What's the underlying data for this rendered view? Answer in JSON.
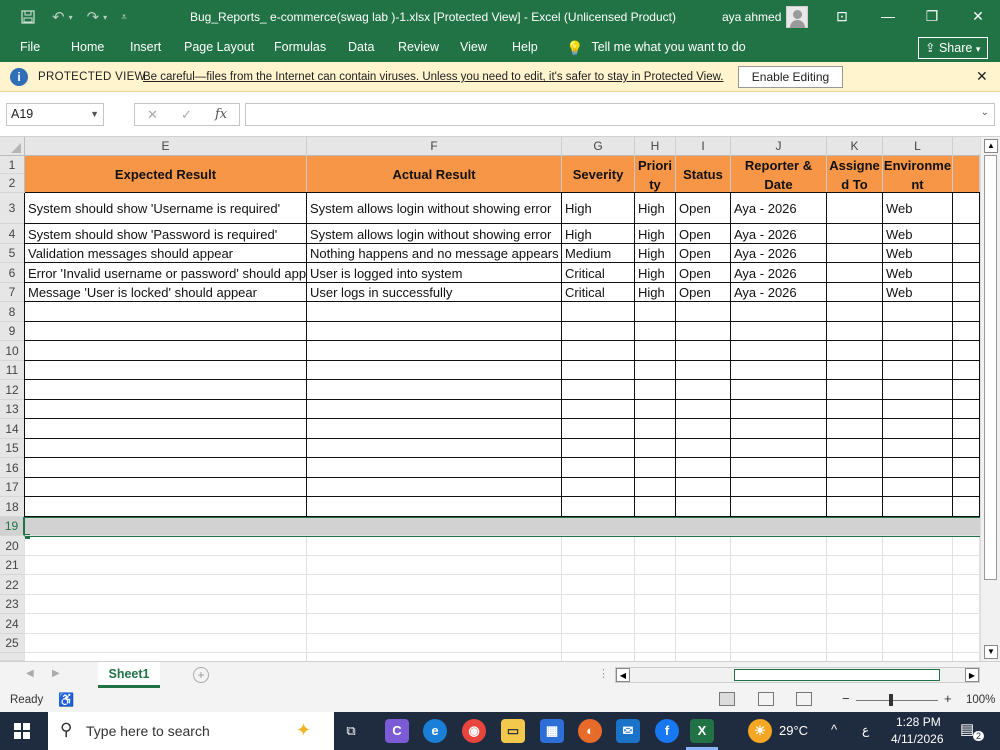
{
  "titlebar": {
    "title": "Bug_Reports_ e-commerce(swag lab )-1.xlsx  [Protected View]  -  Excel (Unlicensed Product)",
    "user": "aya ahmed",
    "icons": [
      "save-icon",
      "undo-icon",
      "redo-icon",
      "customize-qat-icon",
      "ribbon-display-icon",
      "minimize-icon",
      "restore-icon",
      "close-icon"
    ]
  },
  "menu": {
    "items": [
      "File",
      "Home",
      "Insert",
      "Page Layout",
      "Formulas",
      "Data",
      "Review",
      "View",
      "Help"
    ],
    "tell_me": "Tell me what you want to do",
    "share": "Share"
  },
  "protected": {
    "title": "PROTECTED VIEW",
    "message": "Be careful—files from the Internet can contain viruses. Unless you need to edit, it's safer to stay in Protected View.",
    "button": "Enable Editing"
  },
  "formula_bar": {
    "name_box": "A19",
    "fx": "fx",
    "value": ""
  },
  "columns": [
    "E",
    "F",
    "G",
    "H",
    "I",
    "J",
    "K",
    "L"
  ],
  "header_row": {
    "expected": "Expected Result",
    "actual": "Actual Result",
    "severity": "Severity",
    "priority": "Priori ty",
    "status": "Status",
    "reporter": "Reporter & Date",
    "assigned": "Assigne d To",
    "environment": "Environme nt"
  },
  "rows": [
    {
      "expected": "System should show 'Username is required'",
      "actual": "System allows login without showing error",
      "severity": "High",
      "priority": "High",
      "status": "Open",
      "reporter": "Aya - 2026",
      "assigned": "",
      "environment": "Web"
    },
    {
      "expected": "System should show 'Password is required'",
      "actual": "System allows login without showing error",
      "severity": "High",
      "priority": "High",
      "status": "Open",
      "reporter": "Aya - 2026",
      "assigned": "",
      "environment": "Web"
    },
    {
      "expected": "Validation messages should appear",
      "actual": "Nothing happens and no message appears",
      "severity": "Medium",
      "priority": "High",
      "status": "Open",
      "reporter": "Aya - 2026",
      "assigned": "",
      "environment": "Web"
    },
    {
      "expected": "Error 'Invalid username or password' should appear",
      "actual": "User is logged into system",
      "severity": "Critical",
      "priority": "High",
      "status": "Open",
      "reporter": "Aya - 2026",
      "assigned": "",
      "environment": "Web"
    },
    {
      "expected": "Message 'User is locked' should appear",
      "actual": "User logs in successfully",
      "severity": "Critical",
      "priority": "High",
      "status": "Open",
      "reporter": "Aya - 2026",
      "assigned": "",
      "environment": "Web"
    }
  ],
  "row_numbers": [
    "1",
    "2",
    "3",
    "4",
    "5",
    "6",
    "7",
    "8",
    "9",
    "10",
    "11",
    "12",
    "13",
    "14",
    "15",
    "16",
    "17",
    "18",
    "19",
    "20",
    "21",
    "22",
    "23",
    "24",
    "25"
  ],
  "selected_row": "19",
  "sheet_tab": "Sheet1",
  "status": {
    "ready": "Ready",
    "zoom": "100%"
  },
  "taskbar": {
    "search_placeholder": "Type here to search",
    "weather": "29°C",
    "time": "1:28 PM",
    "date": "4/11/2026",
    "lang": "ع",
    "notifications": "2"
  },
  "colors": {
    "excel_green": "#217346",
    "header_orange": "#f79646",
    "protected_yellow": "#fff4ce",
    "taskbar": "#1f2b3e"
  }
}
